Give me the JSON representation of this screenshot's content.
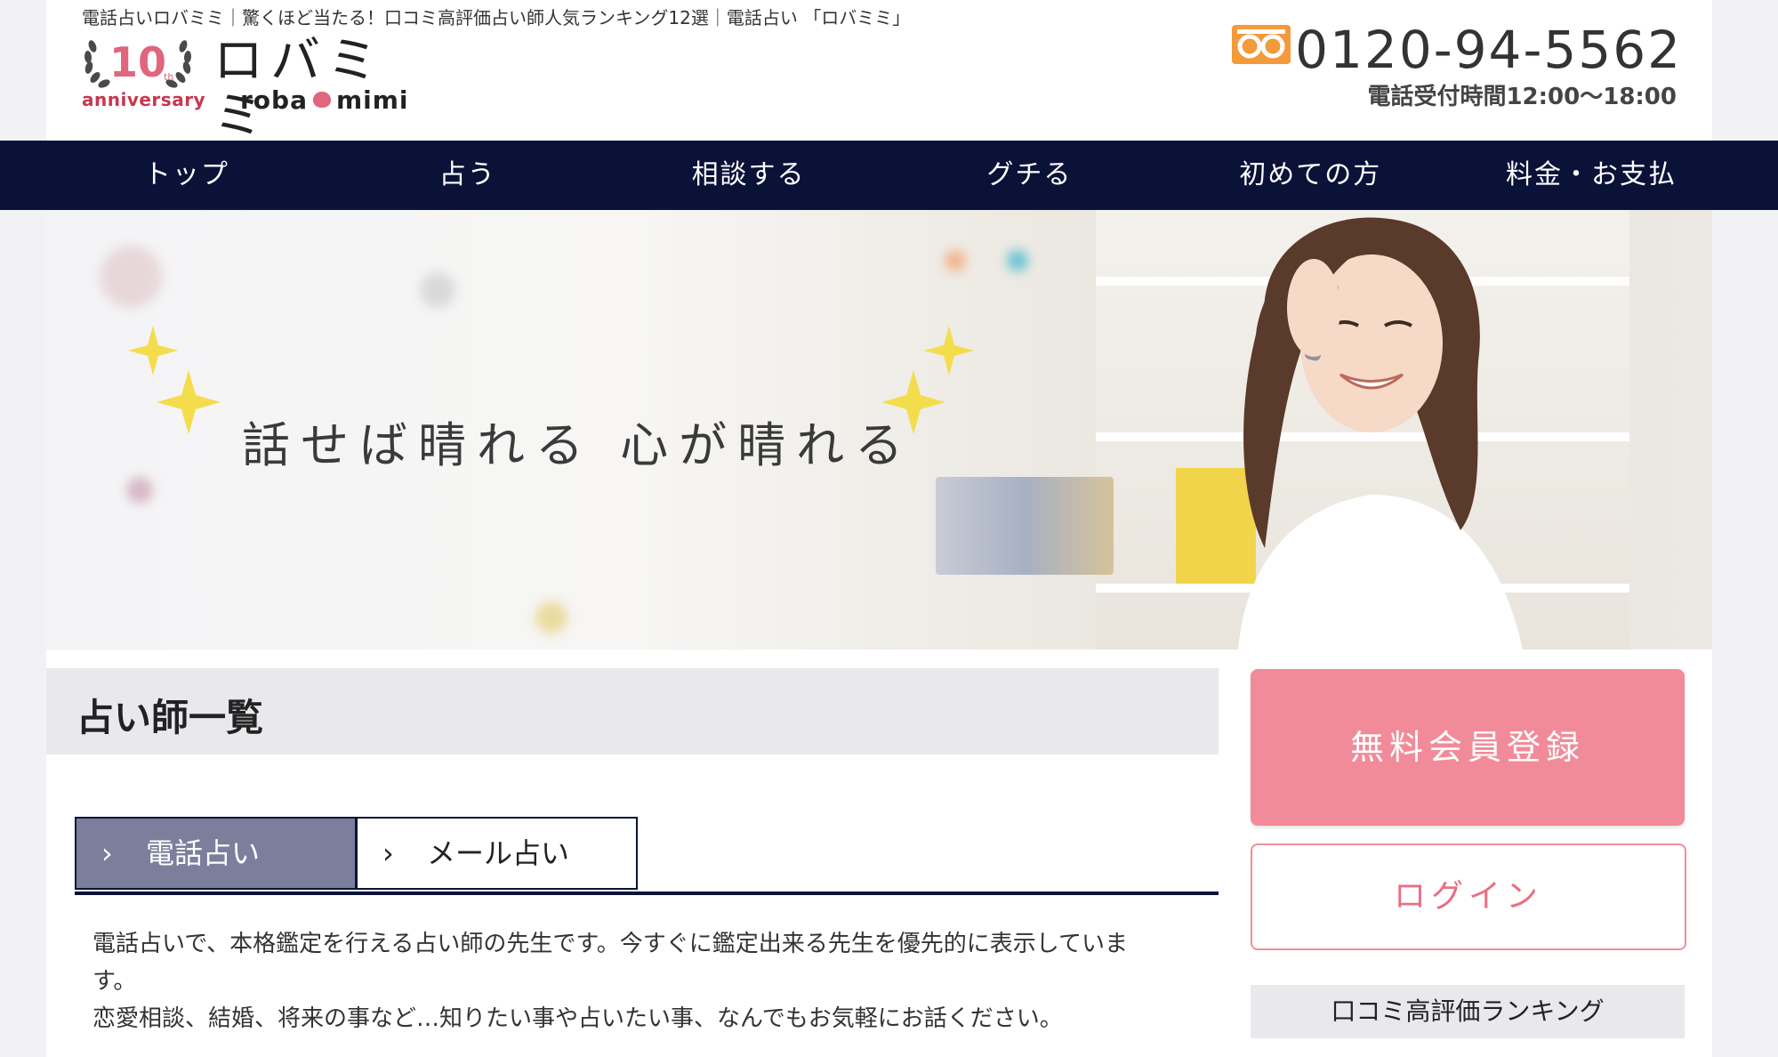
{
  "header": {
    "tagline": "電話占いロバミミ｜驚くほど当たる！口コミ高評価占い師人気ランキング12選｜電話占い 「ロバミミ」",
    "logo": {
      "anniversary_number": "10",
      "anniversary_suffix": "th",
      "anniversary_word": "anniversary",
      "brand_jp": "ロバミミ",
      "brand_en_left": "roba",
      "brand_en_right": "mimi"
    },
    "phone": {
      "number": "0120-94-5562",
      "hours": "電話受付時間12:00〜18:00",
      "icon": "freedial-icon"
    }
  },
  "nav": {
    "items": [
      {
        "label": "トップ"
      },
      {
        "label": "占う"
      },
      {
        "label": "相談する"
      },
      {
        "label": "グチる"
      },
      {
        "label": "初めての方"
      },
      {
        "label": "料金・お支払"
      }
    ]
  },
  "hero": {
    "catchphrase": "話せば晴れる 心が晴れる"
  },
  "main": {
    "section_title": "占い師一覧",
    "tabs": [
      {
        "label": "電話占い",
        "active": true
      },
      {
        "label": "メール占い",
        "active": false
      }
    ],
    "description": [
      "電話占いで、本格鑑定を行える占い師の先生です。今すぐに鑑定出来る先生を優先的に表示していま",
      "す。",
      "恋愛相談、結婚、将来の事など…知りたい事や占いたい事、なんでもお気軽にお話ください。"
    ]
  },
  "sidebar": {
    "register_label": "無料会員登録",
    "login_label": "ログイン",
    "ranking_label": "口コミ高評価ランキング"
  },
  "colors": {
    "nav_bg": "#0b1238",
    "accent_pink": "#f28b99",
    "tab_active": "#7c7f9c",
    "freedial_orange": "#f39a3a",
    "sparkle": "#f3dd4c"
  }
}
